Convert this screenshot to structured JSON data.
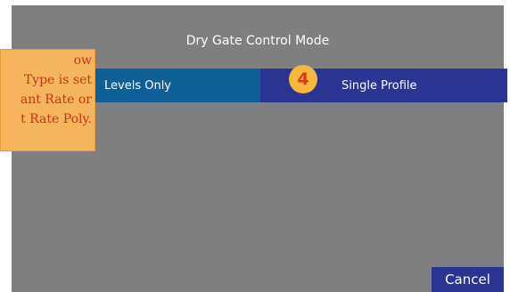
{
  "dialog": {
    "title": "Dry Gate Control Mode",
    "options": [
      {
        "label": "Levels Only",
        "color": "#0e5f98"
      },
      {
        "label": "Single Profile",
        "color": "#2a3493"
      }
    ],
    "cancel_label": "Cancel"
  },
  "callout": {
    "badge_number": "4",
    "badge_color": "#f6b73c",
    "note_lines": [
      "ow",
      "Type is set",
      "ant Rate or",
      "t Rate Poly."
    ],
    "note_color": "#f6b55c"
  }
}
